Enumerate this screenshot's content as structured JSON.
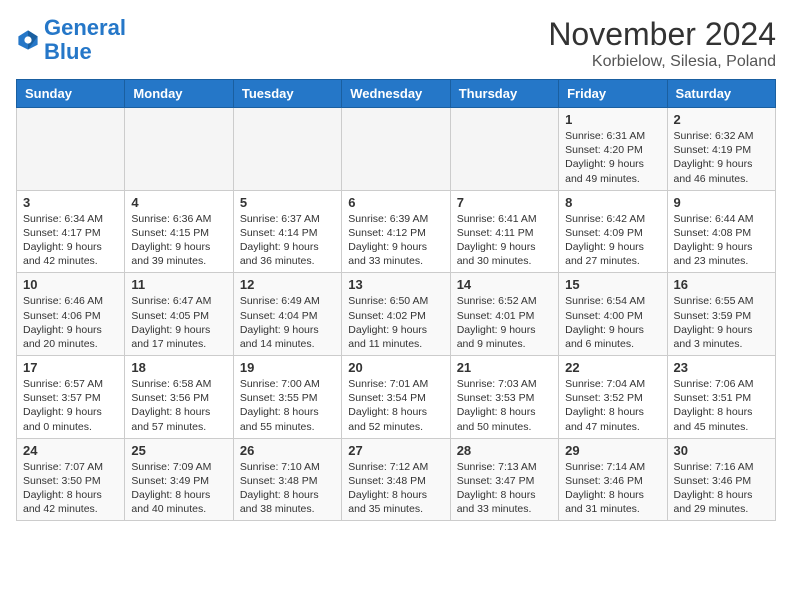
{
  "header": {
    "logo_line1": "General",
    "logo_line2": "Blue",
    "title": "November 2024",
    "subtitle": "Korbielow, Silesia, Poland"
  },
  "calendar": {
    "days_of_week": [
      "Sunday",
      "Monday",
      "Tuesday",
      "Wednesday",
      "Thursday",
      "Friday",
      "Saturday"
    ],
    "weeks": [
      [
        {
          "num": "",
          "info": ""
        },
        {
          "num": "",
          "info": ""
        },
        {
          "num": "",
          "info": ""
        },
        {
          "num": "",
          "info": ""
        },
        {
          "num": "",
          "info": ""
        },
        {
          "num": "1",
          "info": "Sunrise: 6:31 AM\nSunset: 4:20 PM\nDaylight: 9 hours and 49 minutes."
        },
        {
          "num": "2",
          "info": "Sunrise: 6:32 AM\nSunset: 4:19 PM\nDaylight: 9 hours and 46 minutes."
        }
      ],
      [
        {
          "num": "3",
          "info": "Sunrise: 6:34 AM\nSunset: 4:17 PM\nDaylight: 9 hours and 42 minutes."
        },
        {
          "num": "4",
          "info": "Sunrise: 6:36 AM\nSunset: 4:15 PM\nDaylight: 9 hours and 39 minutes."
        },
        {
          "num": "5",
          "info": "Sunrise: 6:37 AM\nSunset: 4:14 PM\nDaylight: 9 hours and 36 minutes."
        },
        {
          "num": "6",
          "info": "Sunrise: 6:39 AM\nSunset: 4:12 PM\nDaylight: 9 hours and 33 minutes."
        },
        {
          "num": "7",
          "info": "Sunrise: 6:41 AM\nSunset: 4:11 PM\nDaylight: 9 hours and 30 minutes."
        },
        {
          "num": "8",
          "info": "Sunrise: 6:42 AM\nSunset: 4:09 PM\nDaylight: 9 hours and 27 minutes."
        },
        {
          "num": "9",
          "info": "Sunrise: 6:44 AM\nSunset: 4:08 PM\nDaylight: 9 hours and 23 minutes."
        }
      ],
      [
        {
          "num": "10",
          "info": "Sunrise: 6:46 AM\nSunset: 4:06 PM\nDaylight: 9 hours and 20 minutes."
        },
        {
          "num": "11",
          "info": "Sunrise: 6:47 AM\nSunset: 4:05 PM\nDaylight: 9 hours and 17 minutes."
        },
        {
          "num": "12",
          "info": "Sunrise: 6:49 AM\nSunset: 4:04 PM\nDaylight: 9 hours and 14 minutes."
        },
        {
          "num": "13",
          "info": "Sunrise: 6:50 AM\nSunset: 4:02 PM\nDaylight: 9 hours and 11 minutes."
        },
        {
          "num": "14",
          "info": "Sunrise: 6:52 AM\nSunset: 4:01 PM\nDaylight: 9 hours and 9 minutes."
        },
        {
          "num": "15",
          "info": "Sunrise: 6:54 AM\nSunset: 4:00 PM\nDaylight: 9 hours and 6 minutes."
        },
        {
          "num": "16",
          "info": "Sunrise: 6:55 AM\nSunset: 3:59 PM\nDaylight: 9 hours and 3 minutes."
        }
      ],
      [
        {
          "num": "17",
          "info": "Sunrise: 6:57 AM\nSunset: 3:57 PM\nDaylight: 9 hours and 0 minutes."
        },
        {
          "num": "18",
          "info": "Sunrise: 6:58 AM\nSunset: 3:56 PM\nDaylight: 8 hours and 57 minutes."
        },
        {
          "num": "19",
          "info": "Sunrise: 7:00 AM\nSunset: 3:55 PM\nDaylight: 8 hours and 55 minutes."
        },
        {
          "num": "20",
          "info": "Sunrise: 7:01 AM\nSunset: 3:54 PM\nDaylight: 8 hours and 52 minutes."
        },
        {
          "num": "21",
          "info": "Sunrise: 7:03 AM\nSunset: 3:53 PM\nDaylight: 8 hours and 50 minutes."
        },
        {
          "num": "22",
          "info": "Sunrise: 7:04 AM\nSunset: 3:52 PM\nDaylight: 8 hours and 47 minutes."
        },
        {
          "num": "23",
          "info": "Sunrise: 7:06 AM\nSunset: 3:51 PM\nDaylight: 8 hours and 45 minutes."
        }
      ],
      [
        {
          "num": "24",
          "info": "Sunrise: 7:07 AM\nSunset: 3:50 PM\nDaylight: 8 hours and 42 minutes."
        },
        {
          "num": "25",
          "info": "Sunrise: 7:09 AM\nSunset: 3:49 PM\nDaylight: 8 hours and 40 minutes."
        },
        {
          "num": "26",
          "info": "Sunrise: 7:10 AM\nSunset: 3:48 PM\nDaylight: 8 hours and 38 minutes."
        },
        {
          "num": "27",
          "info": "Sunrise: 7:12 AM\nSunset: 3:48 PM\nDaylight: 8 hours and 35 minutes."
        },
        {
          "num": "28",
          "info": "Sunrise: 7:13 AM\nSunset: 3:47 PM\nDaylight: 8 hours and 33 minutes."
        },
        {
          "num": "29",
          "info": "Sunrise: 7:14 AM\nSunset: 3:46 PM\nDaylight: 8 hours and 31 minutes."
        },
        {
          "num": "30",
          "info": "Sunrise: 7:16 AM\nSunset: 3:46 PM\nDaylight: 8 hours and 29 minutes."
        }
      ]
    ]
  }
}
